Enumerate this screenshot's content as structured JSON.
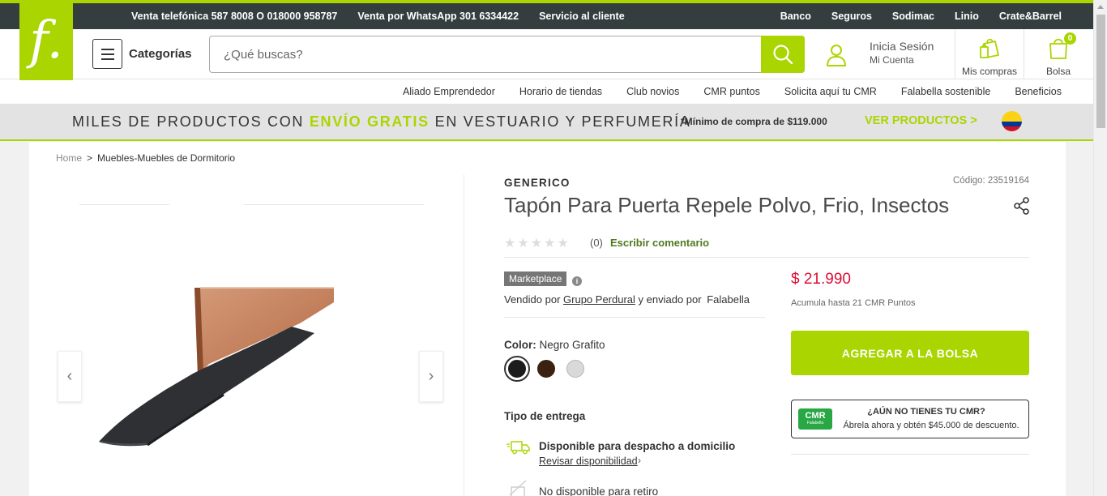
{
  "topbar": {
    "left_links": [
      "Venta telefónica 587 8008 O 018000 958787",
      "Venta por WhatsApp 301 6334422",
      "Servicio al cliente"
    ],
    "right_links": [
      "Banco",
      "Seguros",
      "Sodimac",
      "Linio",
      "Crate&Barrel"
    ]
  },
  "logo": {
    "letter": "f."
  },
  "header": {
    "categorias": "Categorías",
    "search_placeholder": "¿Qué buscas?",
    "login_line1": "Inicia Sesión",
    "login_line2": "Mi Cuenta",
    "mis_compras": "Mis compras",
    "bolsa": "Bolsa",
    "bag_count": "0"
  },
  "subnav": {
    "links": [
      "Aliado Emprendedor",
      "Horario de tiendas",
      "Club novios",
      "CMR puntos",
      "Solicita aquí tu CMR",
      "Falabella sostenible",
      "Beneficios"
    ]
  },
  "promo": {
    "text_before": "MILES DE PRODUCTOS CON",
    "highlight": "ENVÍO GRATIS",
    "text_after": "EN VESTUARIO Y PERFUMERÍA",
    "minimo": "*Mínimo de compra de $119.000",
    "cta": "VER PRODUCTOS >"
  },
  "breadcrumb": {
    "home": "Home",
    "separator": ">",
    "current": "Muebles-Muebles de Dormitorio"
  },
  "product": {
    "brand": "GENERICO",
    "code": "Código: 23519164",
    "title": "Tapón Para Puerta Repele Polvo, Frio, Insectos",
    "rating_stars": "★★★★★",
    "rating_value": 0,
    "rating_count": "(0)",
    "write_comment": "Escribir comentario",
    "marketplace_badge": "Marketplace",
    "info_icon": "i",
    "sold_prefix": "Vendido por",
    "seller": "Grupo Perdural",
    "shipped_prefix": "y enviado por",
    "shipper": "Falabella",
    "price": "$ 21.990",
    "points": "Acumula hasta 21 CMR Puntos",
    "color_label": "Color:",
    "color_value": "Negro Grafito",
    "swatches": [
      {
        "name": "black",
        "color": "#1c1c1c",
        "selected": true
      },
      {
        "name": "brown",
        "color": "#3b2210",
        "selected": false
      },
      {
        "name": "gray",
        "color": "#d9d9d9",
        "selected": false
      }
    ],
    "add_to_bag": "AGREGAR A LA BOLSA",
    "cmr_logo": "CMR",
    "cmr_logo_sub": "Falabella",
    "cmr_title": "¿AÚN NO TIENES TU CMR?",
    "cmr_text": "Ábrela ahora y obtén $45.000 de descuento.",
    "delivery_label": "Tipo de entrega",
    "delivery_option1": "Disponible para despacho a domicilio",
    "check_availability": "Revisar disponibilidad",
    "chevron": "›",
    "delivery_option2": "No disponible para retiro"
  },
  "gallery": {
    "prev": "‹",
    "next": "›"
  },
  "colors": {
    "accent": "#aad500",
    "topbar": "#343e3f",
    "price": "#dd0f35",
    "link": "#507a1f"
  }
}
